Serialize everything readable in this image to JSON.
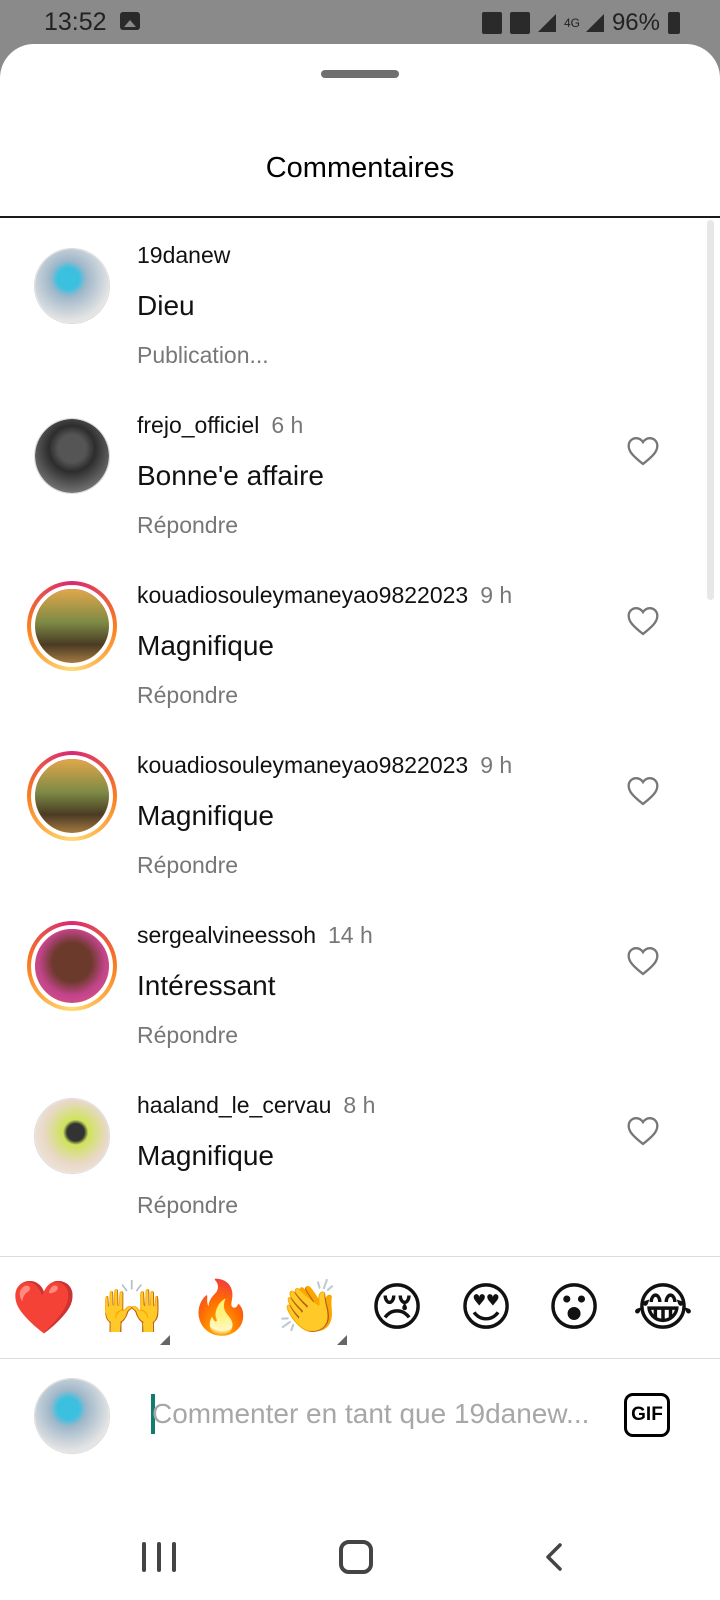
{
  "status_bar": {
    "time": "13:52",
    "battery": "96%",
    "network": "4G",
    "icons": [
      "gallery-icon",
      "sd-card-icon",
      "mute-icon",
      "signal-icon",
      "signal-icon",
      "battery-icon"
    ]
  },
  "sheet": {
    "title": "Commentaires"
  },
  "comments": [
    {
      "username": "19danew",
      "time": "",
      "text": "Dieu",
      "action": "Publication...",
      "liked": false,
      "story_ring": false
    },
    {
      "username": "frejo_officiel",
      "time": "6 h",
      "text": "Bonne'e affaire",
      "action": "Répondre",
      "liked": false,
      "story_ring": false
    },
    {
      "username": "kouadiosouleymaneyao9822023",
      "time": "9 h",
      "text": "Magnifique",
      "action": "Répondre",
      "liked": false,
      "story_ring": true
    },
    {
      "username": "kouadiosouleymaneyao9822023",
      "time": "9 h",
      "text": "Magnifique",
      "action": "Répondre",
      "liked": false,
      "story_ring": true
    },
    {
      "username": "sergealvineessoh",
      "time": "14 h",
      "text": "Intéressant",
      "action": "Répondre",
      "liked": false,
      "story_ring": true
    },
    {
      "username": "haaland_le_cervau",
      "time": "8 h",
      "text": "Magnifique",
      "action": "Répondre",
      "liked": false,
      "story_ring": false
    }
  ],
  "emoji_bar": {
    "emojis": [
      "❤️",
      "🙌",
      "🔥",
      "👏",
      "😢",
      "😍",
      "😮",
      "😂"
    ]
  },
  "comment_input": {
    "placeholder": "Commenter en tant que 19danew...",
    "value": "",
    "gif_label": "GIF"
  },
  "nav_bar": {
    "icons": [
      "recents-icon",
      "home-icon",
      "back-icon"
    ]
  },
  "colors": {
    "story_ring": "#d62976",
    "caret": "#127a6e",
    "secondary_text": "#777777"
  }
}
